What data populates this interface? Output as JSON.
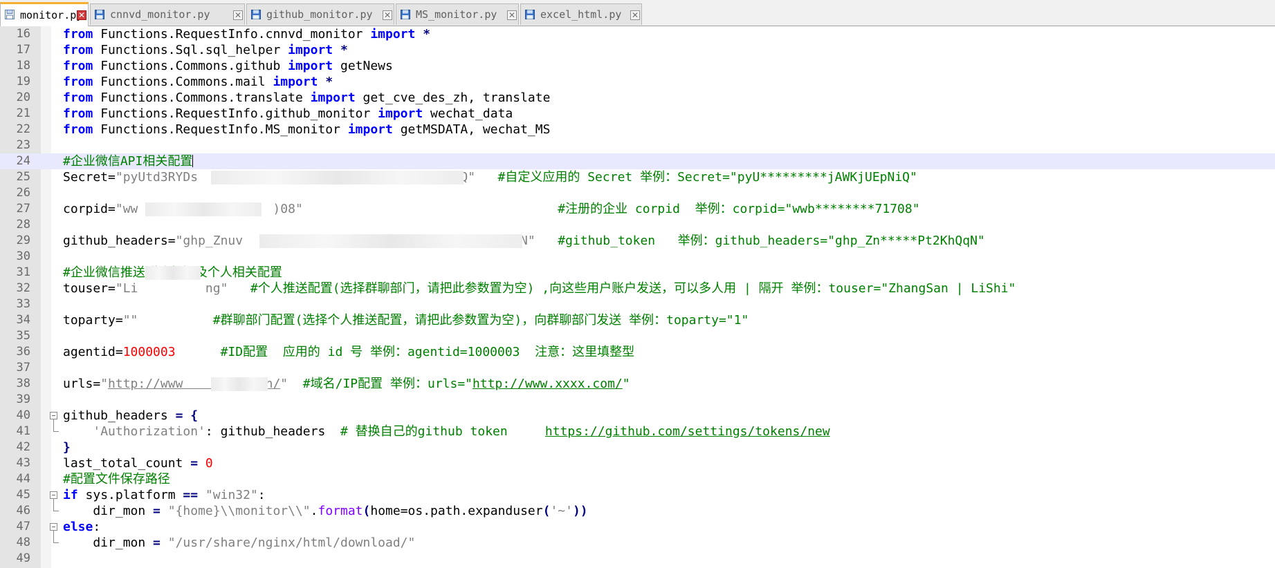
{
  "tabs": [
    {
      "label": "monitor.py",
      "active": true
    },
    {
      "label": "cnnvd_monitor.py",
      "active": false
    },
    {
      "label": "github_monitor.py",
      "active": false
    },
    {
      "label": "MS_monitor.py",
      "active": false
    },
    {
      "label": "excel_html.py",
      "active": false
    }
  ],
  "icons": {
    "file": "floppy-disk-icon",
    "close": "close-x-icon"
  },
  "colors": {
    "keyword": "#0000ff",
    "comment": "#008000",
    "string": "#808080",
    "number": "#ff0000",
    "active_tab_accent": "#f5b030",
    "close_active": "#d23c3c"
  },
  "editor": {
    "lines": [
      {
        "num": "16",
        "t": [
          {
            "k": "kw",
            "v": "from"
          },
          {
            "k": "",
            "v": " Functions.RequestInfo.cnnvd_monitor "
          },
          {
            "k": "kw",
            "v": "import"
          },
          {
            "k": "op",
            "v": " *"
          }
        ]
      },
      {
        "num": "17",
        "t": [
          {
            "k": "kw",
            "v": "from"
          },
          {
            "k": "",
            "v": " Functions.Sql.sql_helper "
          },
          {
            "k": "kw",
            "v": "import"
          },
          {
            "k": "op",
            "v": " *"
          }
        ]
      },
      {
        "num": "18",
        "t": [
          {
            "k": "kw",
            "v": "from"
          },
          {
            "k": "",
            "v": " Functions.Commons.github "
          },
          {
            "k": "kw",
            "v": "import"
          },
          {
            "k": "",
            "v": " getNews"
          }
        ]
      },
      {
        "num": "19",
        "t": [
          {
            "k": "kw",
            "v": "from"
          },
          {
            "k": "",
            "v": " Functions.Commons.mail "
          },
          {
            "k": "kw",
            "v": "import"
          },
          {
            "k": "op",
            "v": " *"
          }
        ]
      },
      {
        "num": "20",
        "t": [
          {
            "k": "kw",
            "v": "from"
          },
          {
            "k": "",
            "v": " Functions.Commons.translate "
          },
          {
            "k": "kw",
            "v": "import"
          },
          {
            "k": "",
            "v": " get_cve_des_zh, translate"
          }
        ]
      },
      {
        "num": "21",
        "t": [
          {
            "k": "kw",
            "v": "from"
          },
          {
            "k": "",
            "v": " Functions.RequestInfo.github_monitor "
          },
          {
            "k": "kw",
            "v": "import"
          },
          {
            "k": "",
            "v": " wechat_data"
          }
        ]
      },
      {
        "num": "22",
        "t": [
          {
            "k": "kw",
            "v": "from"
          },
          {
            "k": "",
            "v": " Functions.RequestInfo.MS_monitor "
          },
          {
            "k": "kw",
            "v": "import"
          },
          {
            "k": "",
            "v": " getMSDATA, wechat_MS"
          }
        ]
      },
      {
        "num": "23",
        "t": []
      },
      {
        "num": "24",
        "cur": true,
        "t": [
          {
            "k": "cm",
            "v": "#企业微信API相关配置"
          }
        ]
      },
      {
        "num": "25",
        "t": [
          {
            "k": "",
            "v": "Secret="
          },
          {
            "k": "st",
            "v": "\"pyUtd3RYDs                                 NiQ\""
          },
          {
            "k": "cm",
            "v": "   #自定义应用的 Secret 举例：Secret=\"pyU*********jAWKjUEpNiQ\""
          }
        ]
      },
      {
        "num": "26",
        "t": []
      },
      {
        "num": "27",
        "t": [
          {
            "k": "",
            "v": "corpid="
          },
          {
            "k": "st",
            "v": "\"ww                  )08\""
          },
          {
            "k": "cm",
            "v": "                                  #注册的企业 corpid  举例：corpid=\"wwb********71708\""
          }
        ]
      },
      {
        "num": "28",
        "t": []
      },
      {
        "num": "29",
        "t": [
          {
            "k": "",
            "v": "github_headers="
          },
          {
            "k": "st",
            "v": "\"ghp_Znuv                                  hQqN\""
          },
          {
            "k": "cm",
            "v": "   #github_token   举例：github_headers=\"ghp_Zn*****Pt2KhQqN\""
          }
        ]
      },
      {
        "num": "30",
        "t": []
      },
      {
        "num": "31",
        "t": [
          {
            "k": "cm",
            "v": "#企业微信推送群聊部门及个人相关配置"
          }
        ]
      },
      {
        "num": "32",
        "t": [
          {
            "k": "",
            "v": "touser="
          },
          {
            "k": "st",
            "v": "\"Li         ng\""
          },
          {
            "k": "cm",
            "v": "   #个人推送配置(选择群聊部门，请把此参数置为空) ,向这些用户账户发送，可以多人用 | 隔开 举例：touser=\"ZhangSan | LiShi\""
          }
        ]
      },
      {
        "num": "33",
        "t": []
      },
      {
        "num": "34",
        "t": [
          {
            "k": "",
            "v": "toparty="
          },
          {
            "k": "st",
            "v": "\"\""
          },
          {
            "k": "cm",
            "v": "          #群聊部门配置(选择个人推送配置，请把此参数置为空)，向群聊部门发送 举例：toparty=\"1\""
          }
        ]
      },
      {
        "num": "35",
        "t": []
      },
      {
        "num": "36",
        "t": [
          {
            "k": "",
            "v": "agentid="
          },
          {
            "k": "nm",
            "v": "1000003"
          },
          {
            "k": "cm",
            "v": "      #ID配置  应用的 id 号 举例：agentid=1000003  注意：这里填整型"
          }
        ]
      },
      {
        "num": "37",
        "t": []
      },
      {
        "num": "38",
        "t": [
          {
            "k": "",
            "v": "urls="
          },
          {
            "k": "st",
            "v": "\""
          },
          {
            "k": "url",
            "v": "http://www         .cn/"
          },
          {
            "k": "st",
            "v": "\""
          },
          {
            "k": "cm",
            "v": "  #域名/IP配置 举例：urls=\""
          },
          {
            "k": "curl",
            "v": "http://www.xxxx.com/"
          },
          {
            "k": "cm",
            "v": "\""
          }
        ]
      },
      {
        "num": "39",
        "t": []
      },
      {
        "num": "40",
        "t": [
          {
            "k": "",
            "v": "github_headers "
          },
          {
            "k": "op",
            "v": "= {"
          }
        ]
      },
      {
        "num": "41",
        "t": [
          {
            "k": "",
            "v": "    "
          },
          {
            "k": "st",
            "v": "'Authorization'"
          },
          {
            "k": "",
            "v": ": github_headers  "
          },
          {
            "k": "cm",
            "v": "# 替换自己的github token     "
          },
          {
            "k": "curl",
            "v": "https://github.com/settings/tokens/new"
          }
        ]
      },
      {
        "num": "42",
        "t": [
          {
            "k": "op",
            "v": "}"
          }
        ]
      },
      {
        "num": "43",
        "t": [
          {
            "k": "",
            "v": "last_total_count "
          },
          {
            "k": "op",
            "v": "="
          },
          {
            "k": "",
            "v": " "
          },
          {
            "k": "nm",
            "v": "0"
          }
        ]
      },
      {
        "num": "44",
        "t": [
          {
            "k": "cm",
            "v": "#配置文件保存路径"
          }
        ]
      },
      {
        "num": "45",
        "t": [
          {
            "k": "kw",
            "v": "if"
          },
          {
            "k": "",
            "v": " sys.platform "
          },
          {
            "k": "op",
            "v": "=="
          },
          {
            "k": "",
            "v": " "
          },
          {
            "k": "st",
            "v": "\"win32\""
          },
          {
            "k": "",
            "v": ":"
          }
        ]
      },
      {
        "num": "46",
        "t": [
          {
            "k": "",
            "v": "    dir_mon "
          },
          {
            "k": "op",
            "v": "="
          },
          {
            "k": "",
            "v": " "
          },
          {
            "k": "st",
            "v": "\"{home}\\\\monitor\\\\\""
          },
          {
            "k": "",
            "v": "."
          },
          {
            "k": "fn",
            "v": "format"
          },
          {
            "k": "op",
            "v": "("
          },
          {
            "k": "",
            "v": "home=os.path.expanduser"
          },
          {
            "k": "op",
            "v": "("
          },
          {
            "k": "st",
            "v": "'~'"
          },
          {
            "k": "op",
            "v": "))"
          }
        ]
      },
      {
        "num": "47",
        "t": [
          {
            "k": "kw",
            "v": "else"
          },
          {
            "k": "",
            "v": ":"
          }
        ]
      },
      {
        "num": "48",
        "t": [
          {
            "k": "",
            "v": "    dir_mon "
          },
          {
            "k": "op",
            "v": "="
          },
          {
            "k": "",
            "v": " "
          },
          {
            "k": "st",
            "v": "\"/usr/share/nginx/html/download/\""
          }
        ]
      },
      {
        "num": "49",
        "t": []
      }
    ]
  }
}
